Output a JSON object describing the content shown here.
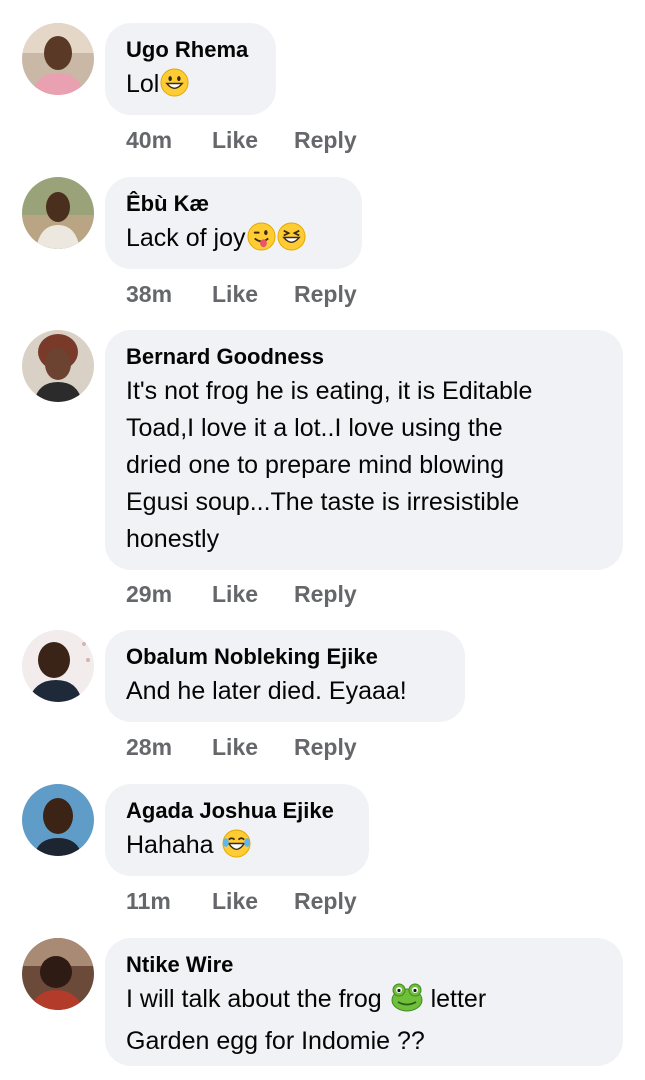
{
  "comments": [
    {
      "author": "Ugo Rhema",
      "text": "Lol",
      "emojis": [
        "grinning-face"
      ],
      "time": "40m",
      "like_label": "Like",
      "reply_label": "Reply"
    },
    {
      "author": "Êbù Kæ",
      "text": "Lack of joy",
      "emojis": [
        "winking-face-with-tongue",
        "grinning-squinting-face"
      ],
      "time": "38m",
      "like_label": "Like",
      "reply_label": "Reply"
    },
    {
      "author": "Bernard Goodness",
      "text_lines": [
        "It's not frog he is eating, it is Editable",
        "Toad,I love it a lot..I love using the",
        "dried one to prepare mind blowing",
        "Egusi soup...The taste is irresistible",
        "honestly"
      ],
      "time": "29m",
      "like_label": "Like",
      "reply_label": "Reply"
    },
    {
      "author": "Obalum Nobleking Ejike",
      "text": "And he later died. Eyaaa!",
      "time": "28m",
      "like_label": "Like",
      "reply_label": "Reply"
    },
    {
      "author": "Agada Joshua Ejike",
      "text": "Hahaha ",
      "emojis": [
        "face-with-tears-of-joy"
      ],
      "time": "11m",
      "like_label": "Like",
      "reply_label": "Reply"
    },
    {
      "author": "Ntike Wire",
      "text_line1_before": "I will talk about the frog ",
      "text_line1_after": "  letter",
      "text_line2": "Garden egg for Indomie  ??",
      "emojis": [
        "frog-face"
      ],
      "time": "",
      "like_label": "",
      "reply_label": ""
    }
  ],
  "colors": {
    "bubble_bg": "#f0f2f5",
    "text": "#050505",
    "meta": "#65676b",
    "emoji_yellow": "#ffcc33",
    "frog_green": "#6fbf3b"
  }
}
